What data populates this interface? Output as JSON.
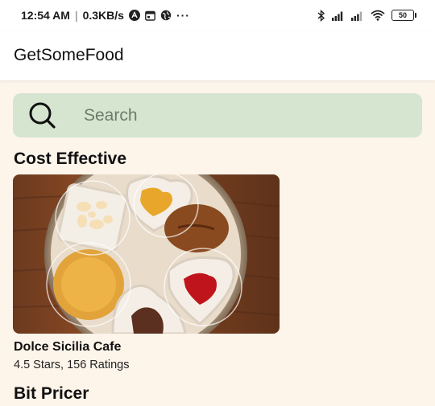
{
  "status_bar": {
    "time": "12:54 AM",
    "separator": "|",
    "speed": "0.3KB/s",
    "dots": "···",
    "battery": "50",
    "icons": [
      "app-a-icon",
      "calendar-icon",
      "globe-icon",
      "bluetooth-icon",
      "signal-icon",
      "signal-icon",
      "wifi-icon",
      "battery-icon"
    ]
  },
  "app_bar": {
    "title": "GetSomeFood"
  },
  "search": {
    "placeholder": "Search",
    "value": ""
  },
  "sections": [
    {
      "title": "Cost Effective"
    },
    {
      "title": "Bit Pricer"
    }
  ],
  "cards": [
    {
      "name": "Dolce Sicilia Cafe",
      "rating_text": "4.5 Stars, 156 Ratings",
      "image": "cookies-photo"
    }
  ],
  "colors": {
    "background": "#fdf4ea",
    "search_bg": "#d5e5cf",
    "app_bar": "#ffffff"
  }
}
